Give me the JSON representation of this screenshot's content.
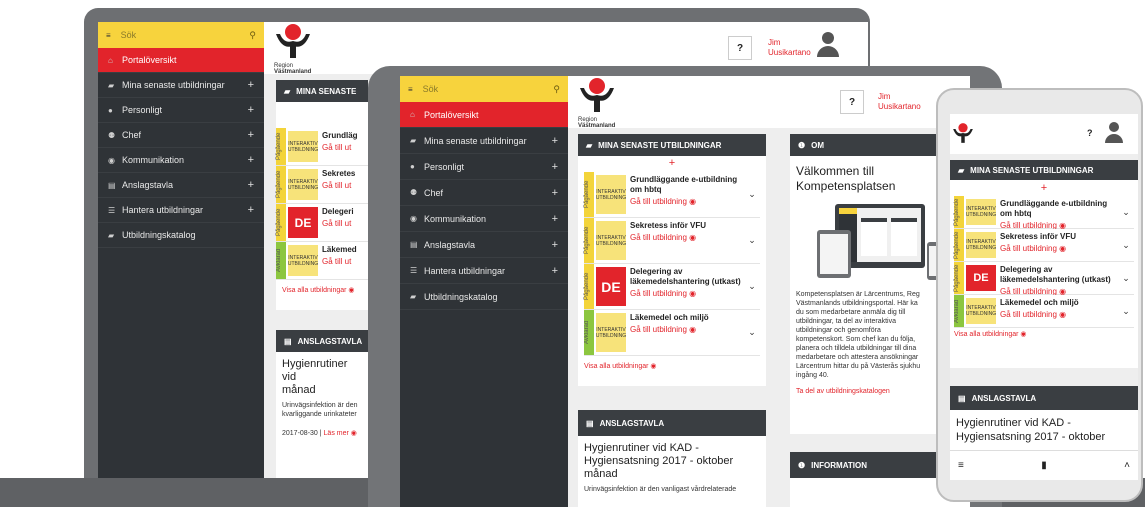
{
  "app": {
    "search_placeholder": "Sök",
    "logo_line1": "Region",
    "logo_line2": "Västmanland",
    "user_first": "Jim",
    "user_last": "Uusikartano",
    "help_icon": "?",
    "menu_icon": "≡",
    "search_icon": "⚲",
    "plus": "+"
  },
  "nav": [
    {
      "label": "Portalöversikt",
      "icon": "home-icon",
      "glyph": "⌂",
      "active": true,
      "expandable": false
    },
    {
      "label": "Mina senaste utbildningar",
      "icon": "book-icon",
      "glyph": "▰",
      "active": false,
      "expandable": true
    },
    {
      "label": "Personligt",
      "icon": "person-icon",
      "glyph": "●",
      "active": false,
      "expandable": true
    },
    {
      "label": "Chef",
      "icon": "group-icon",
      "glyph": "⚉",
      "active": false,
      "expandable": true
    },
    {
      "label": "Kommunikation",
      "icon": "chat-icon",
      "glyph": "◉",
      "active": false,
      "expandable": true
    },
    {
      "label": "Anslagstavla",
      "icon": "board-icon",
      "glyph": "▤",
      "active": false,
      "expandable": true
    },
    {
      "label": "Hantera utbildningar",
      "icon": "list-icon",
      "glyph": "☰",
      "active": false,
      "expandable": true
    },
    {
      "label": "Utbildningskatalog",
      "icon": "catalog-icon",
      "glyph": "▰",
      "active": false,
      "expandable": false
    }
  ],
  "courses_panel": {
    "title": "MINA SENASTE UTBILDNINGAR",
    "title_short": "MINA SENASTE",
    "items": [
      {
        "status": "Pågående",
        "status_color": "#f3d43a",
        "thumb": "INTERAKTIV UTBILDNING",
        "title": "Grundläggande e-utbildning om hbtq",
        "title_cut": "Grundläg",
        "link": "Gå till utbildning"
      },
      {
        "status": "Pågående",
        "status_color": "#f3d43a",
        "thumb": "INTERAKTIV UTBILDNING",
        "title": "Sekretess inför VFU",
        "title_cut": "Sekretes",
        "link": "Gå till utbildning"
      },
      {
        "status": "Pågående",
        "status_color": "#f3d43a",
        "thumb": "DE",
        "title": "Delegering av läkemedelshantering (utkast)",
        "title_cut": "Delegeri",
        "link": "Gå till utbildning"
      },
      {
        "status": "Avklarad",
        "status_color": "#8cc63f",
        "thumb": "INTERAKTIV UTBILDNING",
        "title": "Läkemedel och miljö",
        "title_cut": "Läkemed",
        "link": "Gå till utbildning"
      }
    ],
    "see_all": "Visa alla utbildningar",
    "link_short": "Gå till ut"
  },
  "board_panel": {
    "title": "ANSLAGSTAVLA",
    "headline": "Hygienrutiner vid KAD - Hygiensatsning 2017 - oktober månad",
    "headline_cut1": "Hygienrutiner vid",
    "headline_cut2": "månad",
    "phone_headline1": "Hygienrutiner vid KAD -",
    "phone_headline2": "Hygiensatsning 2017 - oktober",
    "body": "Urinvägsinfektion är den vanligast vårdrelaterade",
    "body_cut1": "Urinvägsinfektion är den",
    "body_cut2": "kvarliggande urinkateter",
    "date": "2017-08-30",
    "read_more": "Läs mer"
  },
  "about_panel": {
    "title": "OM",
    "heading1": "Välkommen till",
    "heading2": "Kompetensplatsen",
    "text": [
      "Kompetensplatsen är Lärcentrums, Reg",
      "Västmanlands utbildningsportal. Här ka",
      "du som medarbetare anmäla dig till",
      "utbildningar, ta del av interaktiva",
      "utbildningar och genomföra",
      "kompetenskort. Som chef kan du följa,",
      "planera och tilldela utbildningar till dina",
      "medarbetare och attestera ansökningar",
      "Lärcentrum hittar du på Västerås sjukhu",
      "ingång 40."
    ],
    "catalog_link": "Ta del av utbildningskatalogen"
  },
  "info_panel": {
    "title": "INFORMATION"
  },
  "colors": {
    "accent": "#e2242b",
    "search": "#f7d33d",
    "sidebar": "#2f3337",
    "panel_head": "#3a3e42",
    "pending": "#f3d43a",
    "done": "#8cc63f",
    "frame": "#6d6f72"
  }
}
